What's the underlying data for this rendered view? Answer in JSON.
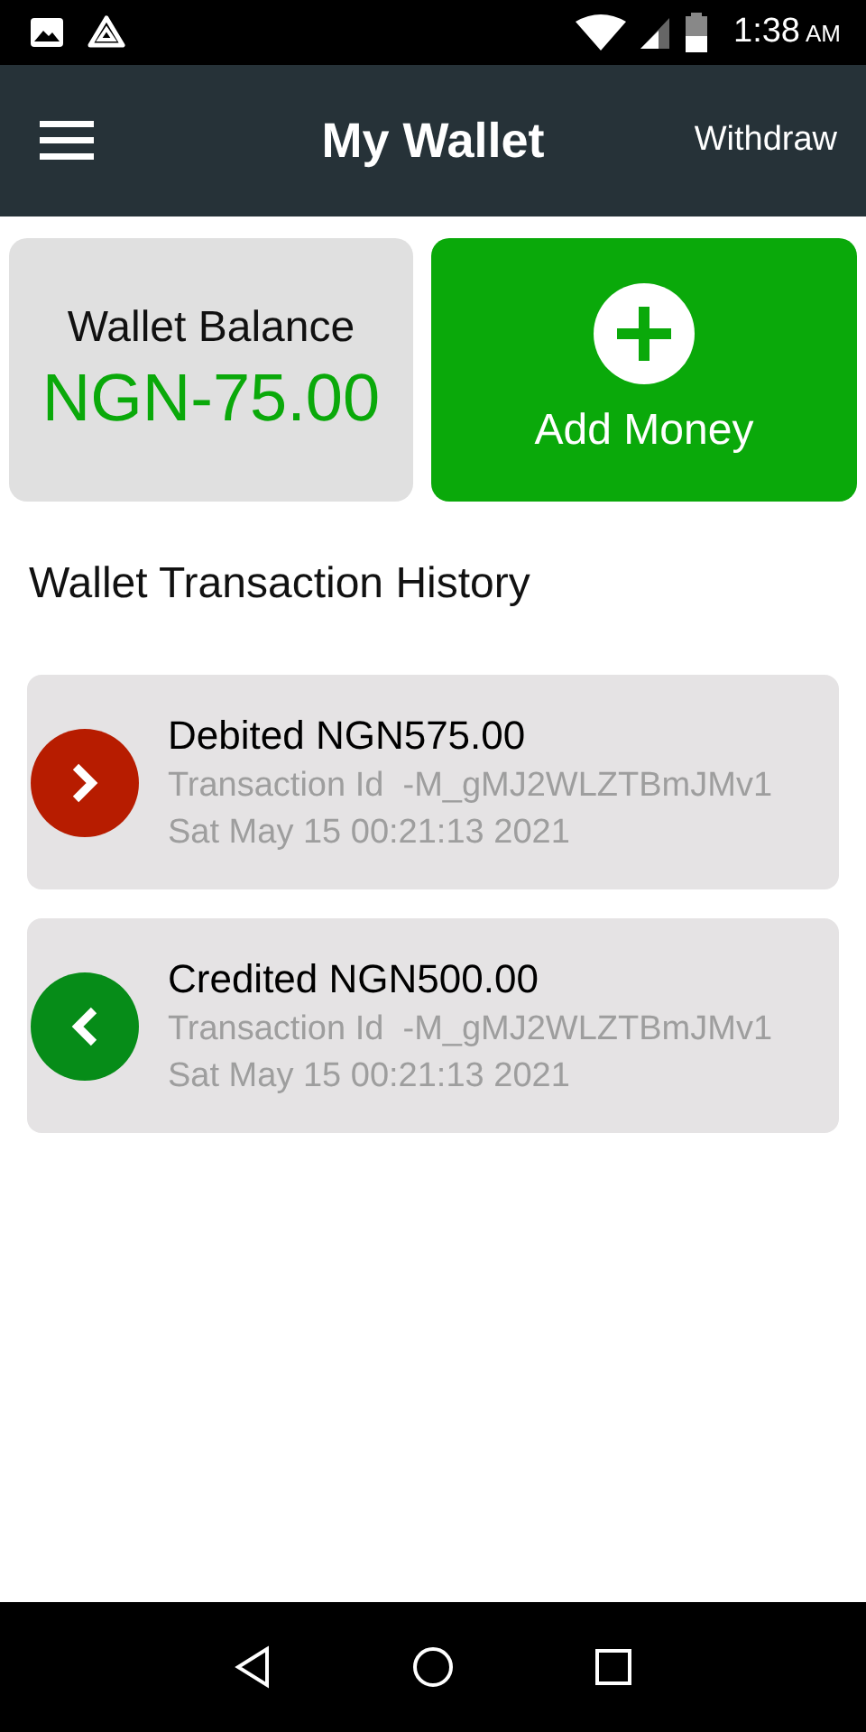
{
  "status_bar": {
    "time": "1:38",
    "meridiem": "AM"
  },
  "app_bar": {
    "title": "My Wallet",
    "action": "Withdraw"
  },
  "balance": {
    "label": "Wallet Balance",
    "amount": "NGN-75.00"
  },
  "add_money": {
    "label": "Add Money"
  },
  "history": {
    "title": "Wallet Transaction History",
    "transactions": [
      {
        "kind": "debit",
        "title": "Debited NGN575.00",
        "transaction_id": "Transaction Id  -M_gMJ2WLZTBmJMv1",
        "date": "Sat May 15 00:21:13 2021"
      },
      {
        "kind": "credit",
        "title": "Credited NGN500.00",
        "transaction_id": "Transaction Id  -M_gMJ2WLZTBmJMv1",
        "date": "Sat May 15 00:21:13 2021"
      }
    ]
  }
}
